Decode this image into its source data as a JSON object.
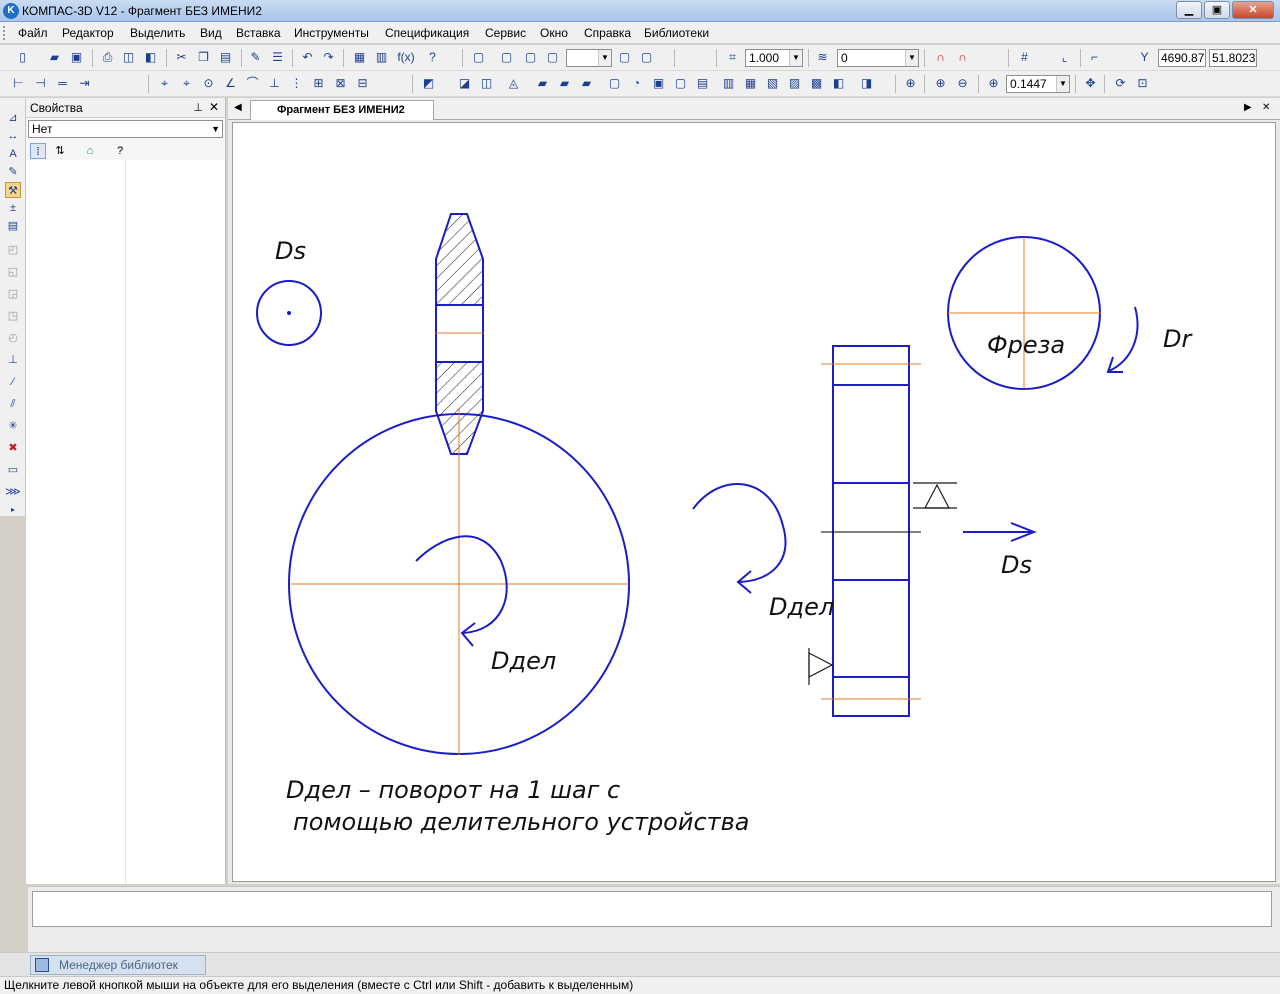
{
  "window": {
    "title": "КОМПАС-3D V12 - Фрагмент БЕЗ ИМЕНИ2",
    "app_icon_letter": "K"
  },
  "menu": [
    "Файл",
    "Редактор",
    "Выделить",
    "Вид",
    "Вставка",
    "Инструменты",
    "Спецификация",
    "Сервис",
    "Окно",
    "Справка",
    "Библиотеки"
  ],
  "toolbar": {
    "scale_value": "1.000",
    "layer_value": "0",
    "coord_x": "4690.87",
    "coord_y": "51.8023",
    "zoom_value": "0.1447"
  },
  "properties_panel": {
    "title": "Свойства",
    "object_select": "Нет"
  },
  "document_tab": "Фрагмент БЕЗ ИМЕНИ2",
  "drawing": {
    "label_ds_top": "Ds",
    "label_ddel_main": "Dдел",
    "label_freza": "Фреза",
    "label_dr": "Dr",
    "label_ddel_side": "Dдел",
    "label_ds_side": "Ds",
    "note_line1": "Dдел – поворот на 1 шаг с",
    "note_line2": "помощью делительного устройства"
  },
  "library_manager": "Менеджер библиотек",
  "status_text": "Щелкните левой кнопкой мыши на объекте для его выделения (вместе с Ctrl или Shift - добавить к выделенным)",
  "colors": {
    "outline": "#1c1cc8",
    "axis": "#e07a20",
    "hatch": "#1a1a1a"
  }
}
